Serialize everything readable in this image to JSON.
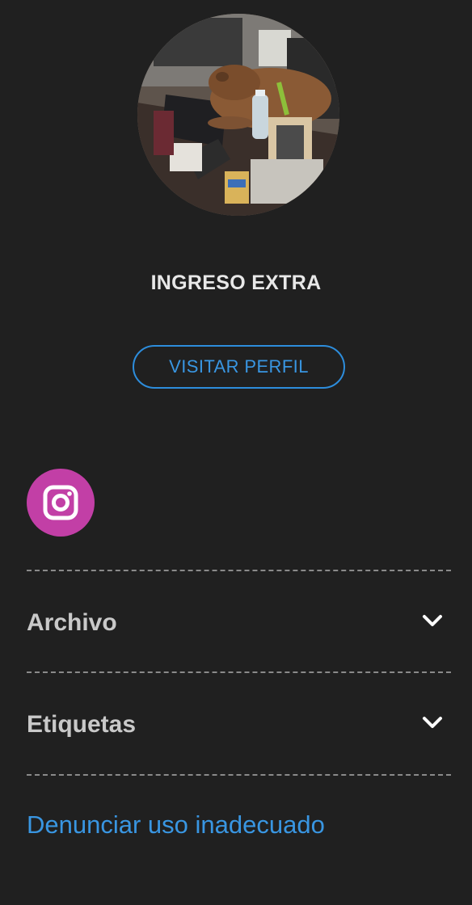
{
  "profile": {
    "name": "INGRESO EXTRA",
    "visit_button_label": "VISITAR PERFIL",
    "avatar_description": "capybara-on-desk-photo"
  },
  "social": {
    "icon": "instagram-icon",
    "color": "#c23fa6"
  },
  "sections": [
    {
      "label": "Archivo",
      "icon": "chevron-down-icon"
    },
    {
      "label": "Etiquetas",
      "icon": "chevron-down-icon"
    }
  ],
  "report_link": "Denunciar uso inadecuado",
  "colors": {
    "background": "#202020",
    "accent": "#3996e2",
    "text": "#e8e8e8"
  }
}
